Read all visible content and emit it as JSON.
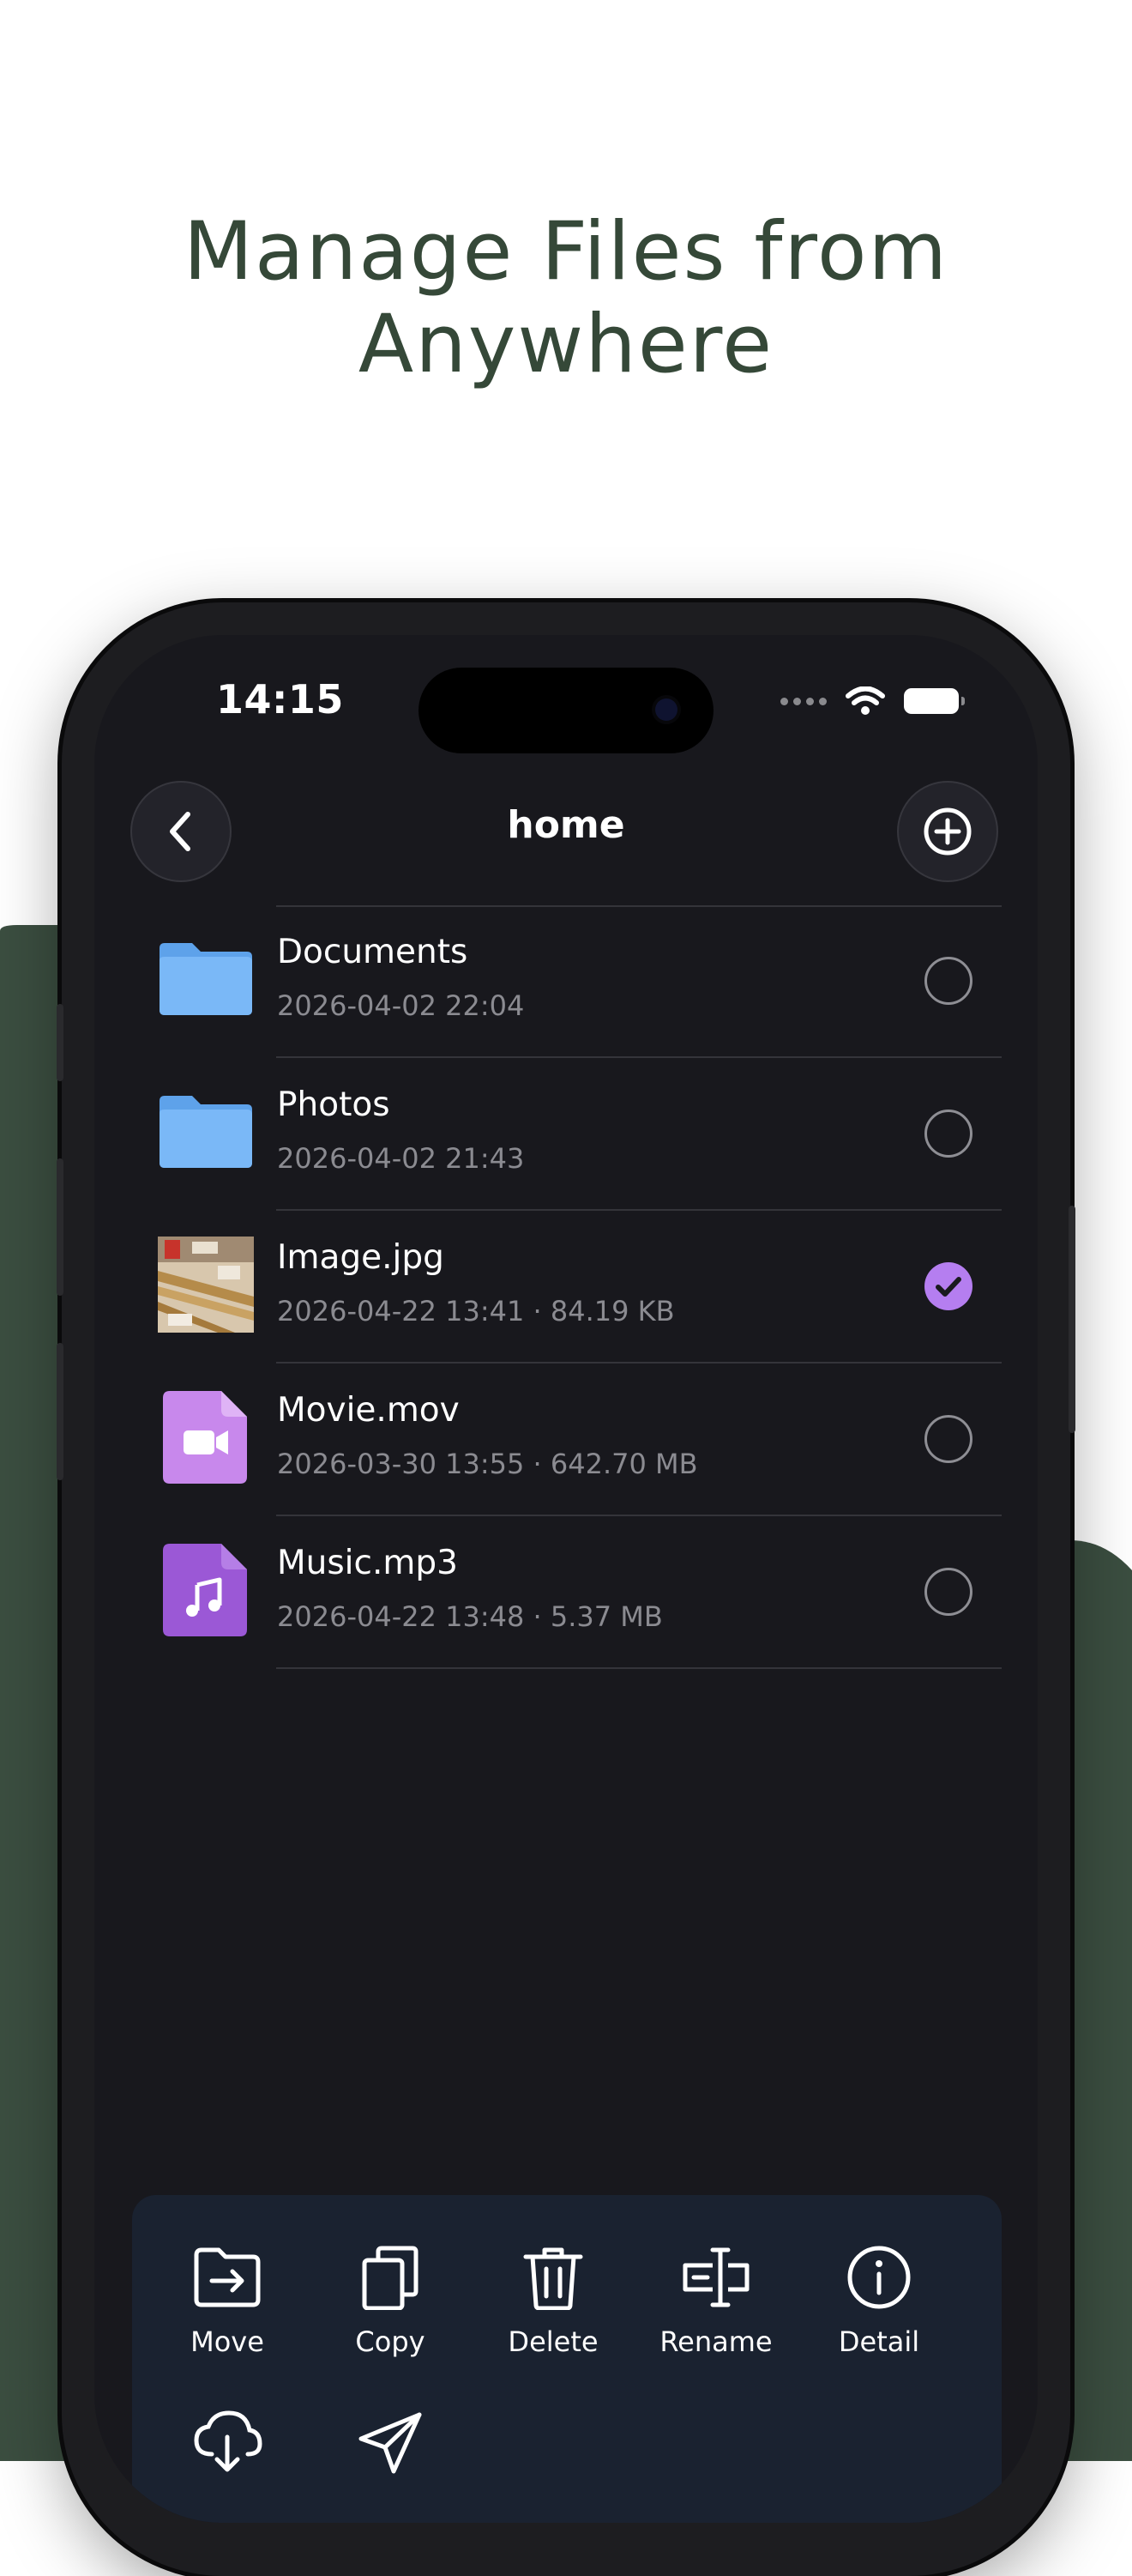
{
  "promo": {
    "headline_line1": "Manage Files from",
    "headline_line2": "Anywhere"
  },
  "status_bar": {
    "time": "14:15"
  },
  "nav": {
    "title": "home",
    "back_icon": "chevron-left-icon",
    "add_icon": "plus-circle-icon"
  },
  "files": [
    {
      "name": "Documents",
      "meta": "2026-04-02 22:04",
      "kind": "folder",
      "selected": false
    },
    {
      "name": "Photos",
      "meta": "2026-04-02 21:43",
      "kind": "folder",
      "selected": false
    },
    {
      "name": "Image.jpg",
      "meta": "2026-04-22 13:41 · 84.19 KB",
      "kind": "image",
      "selected": true
    },
    {
      "name": "Movie.mov",
      "meta": "2026-03-30 13:55 · 642.70 MB",
      "kind": "video",
      "selected": false
    },
    {
      "name": "Music.mp3",
      "meta": "2026-04-22 13:48 · 5.37 MB",
      "kind": "audio",
      "selected": false
    }
  ],
  "toolbar": {
    "move": "Move",
    "copy": "Copy",
    "delete": "Delete",
    "rename": "Rename",
    "detail": "Detail"
  },
  "colors": {
    "brand_green": "#3b4e40",
    "headline": "#354838",
    "accent_purple": "#b57ef0",
    "folder_blue": "#6fb0f5"
  }
}
